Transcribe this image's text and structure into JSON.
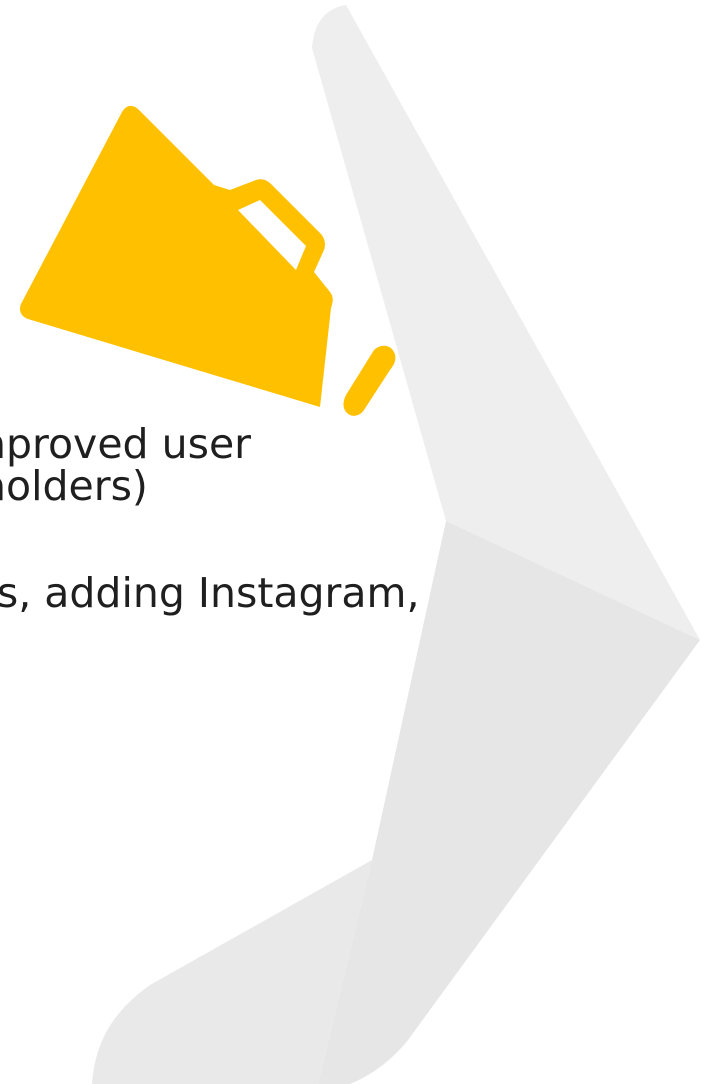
{
  "text": {
    "line1": "nproved user",
    "line2": "holders)",
    "line3": "rs, adding Instagram,"
  },
  "icons": {
    "megaphone": "megaphone-icon",
    "background": "arrow-shape"
  },
  "colors": {
    "megaphone": "#FFC000",
    "background_light": "#EEEEEE",
    "background_dark": "#E6E6E6",
    "text": "#1F1F1F",
    "page": "#FFFFFF"
  }
}
